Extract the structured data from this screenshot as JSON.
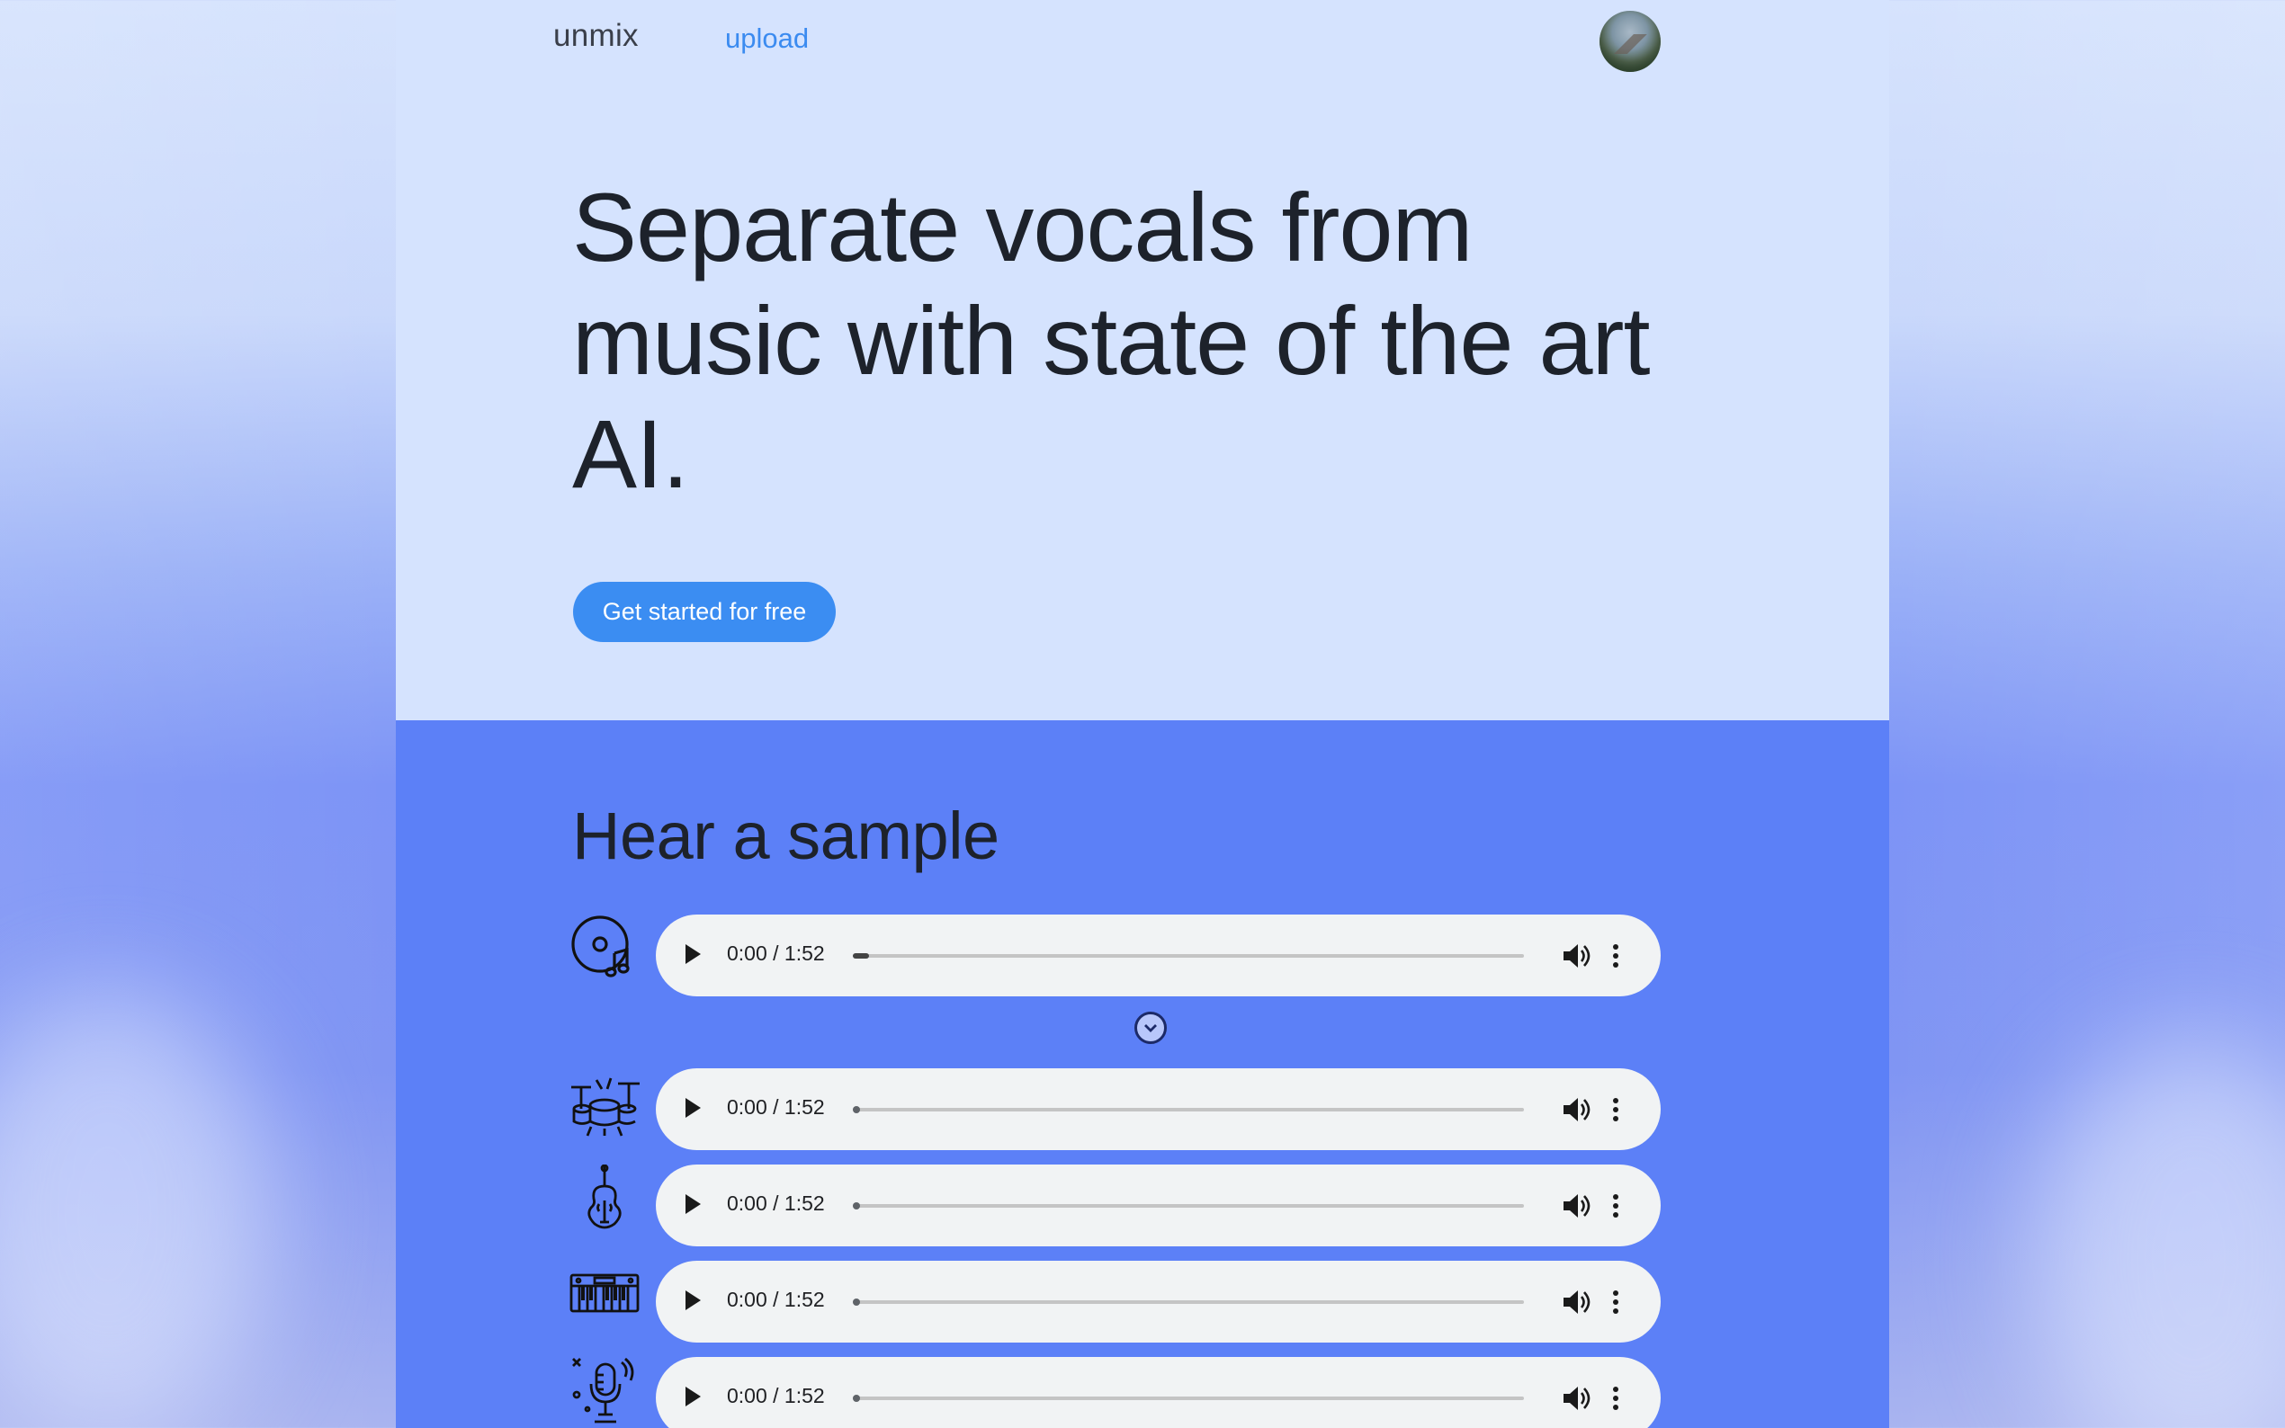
{
  "nav": {
    "brand": "unmix",
    "upload_link": "upload",
    "avatar_icon": "user-avatar"
  },
  "hero": {
    "headline": "Separate vocals from music with state of the art AI.",
    "cta_label": "Get started for free"
  },
  "samples": {
    "title": "Hear a sample",
    "expand_icon": "chevron-down-icon",
    "tracks": [
      {
        "icon": "music-disc-icon",
        "time": "0:00 / 1:52",
        "progress": 0.0
      },
      {
        "icon": "drums-icon",
        "time": "0:00 / 1:52",
        "progress": 0.0
      },
      {
        "icon": "violin-icon",
        "time": "0:00 / 1:52",
        "progress": 0.0
      },
      {
        "icon": "keyboard-icon",
        "time": "0:00 / 1:52",
        "progress": 0.0
      },
      {
        "icon": "microphone-icon",
        "time": "0:00 / 1:52",
        "progress": 0.0
      }
    ]
  },
  "colors": {
    "hero_bg": "#d5e3fe",
    "samples_bg": "#5c80f7",
    "accent": "#3b8df2",
    "text": "#1d222b"
  }
}
